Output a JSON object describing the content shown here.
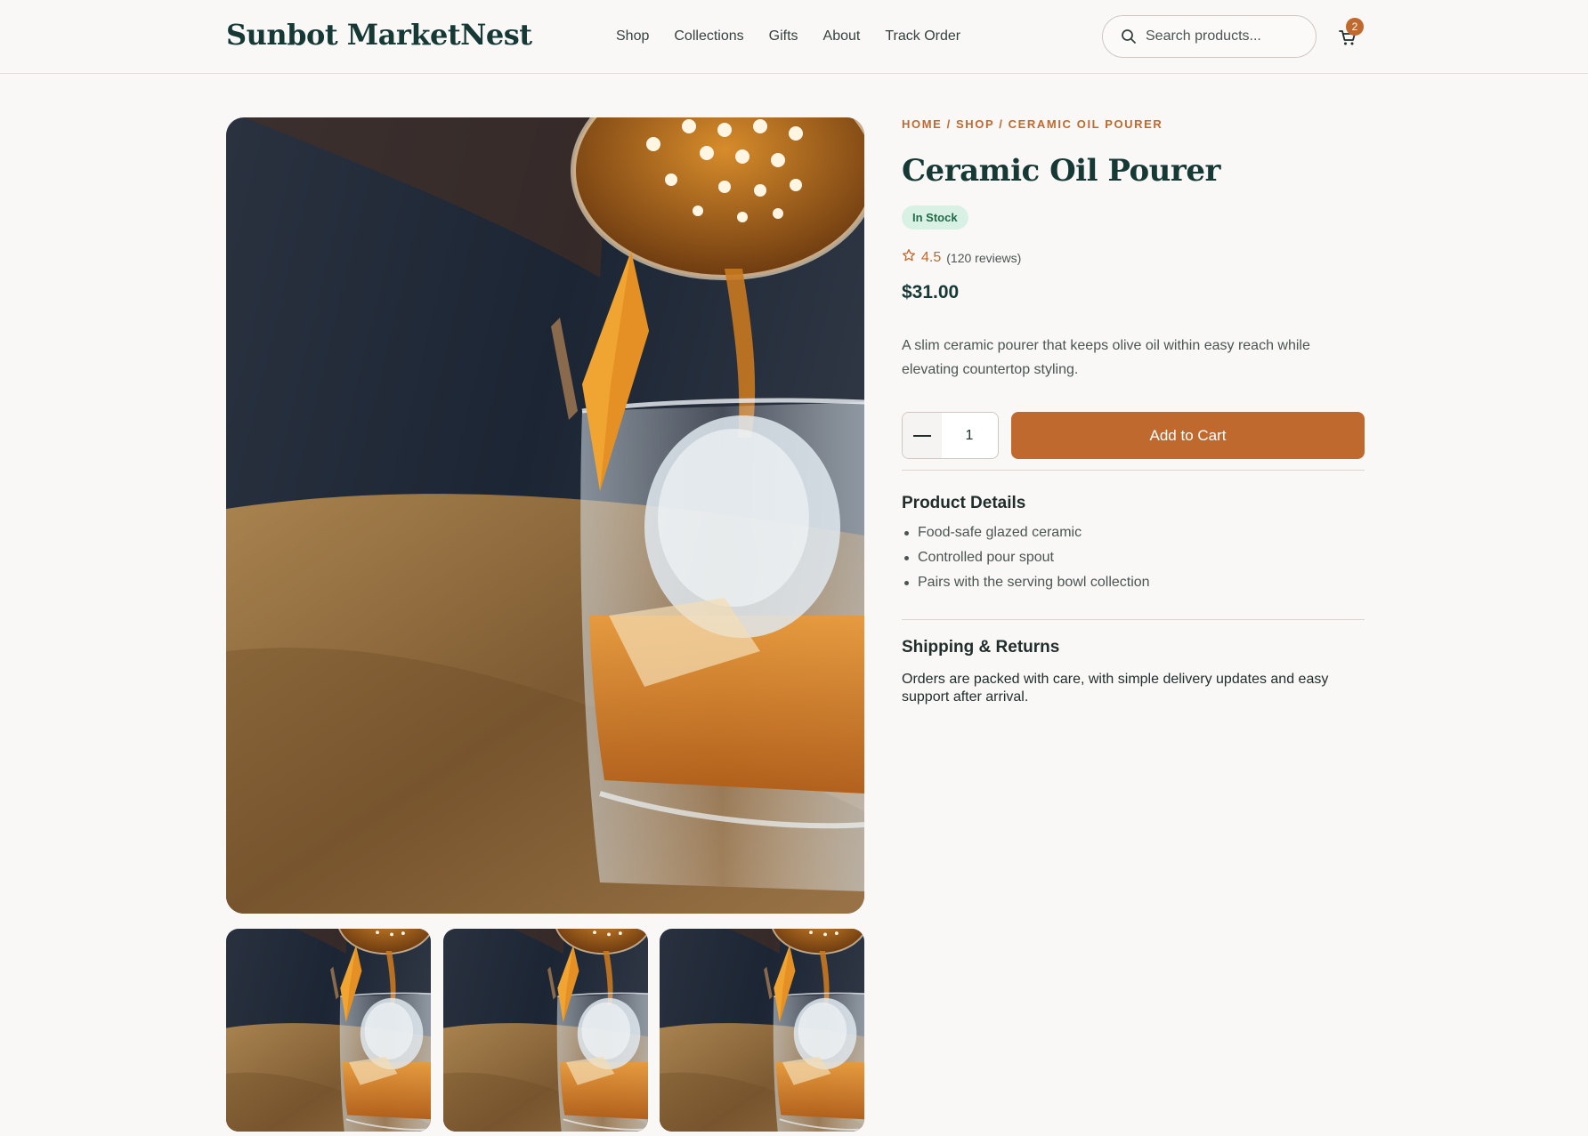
{
  "header": {
    "brand": "Sunbot MarketNest",
    "nav": [
      "Shop",
      "Collections",
      "Gifts",
      "About",
      "Track Order"
    ],
    "search_placeholder": "Search products...",
    "cart_count": "2"
  },
  "product": {
    "breadcrumb": "HOME / SHOP / CERAMIC OIL POURER",
    "title": "Ceramic Oil Pourer",
    "stock": "In Stock",
    "rating": "4.5",
    "reviews": "(120 reviews)",
    "price": "$31.00",
    "description": "A slim ceramic pourer that keeps olive oil within easy reach while elevating countertop styling.",
    "quantity": "1",
    "add_to_cart_label": "Add to Cart"
  },
  "details": {
    "title": "Product Details",
    "items": [
      "Food-safe glazed ceramic",
      "Controlled pour spout",
      "Pairs with the serving bowl collection"
    ]
  },
  "shipping": {
    "title": "Shipping & Returns",
    "text": "Orders are packed with care, with simple delivery updates and easy support after arrival."
  },
  "colors": {
    "brand": "#163936",
    "accent": "#c0692f",
    "stock_bg": "#d9f1e4",
    "stock_text": "#1e6b45",
    "background": "#faf8f6"
  }
}
